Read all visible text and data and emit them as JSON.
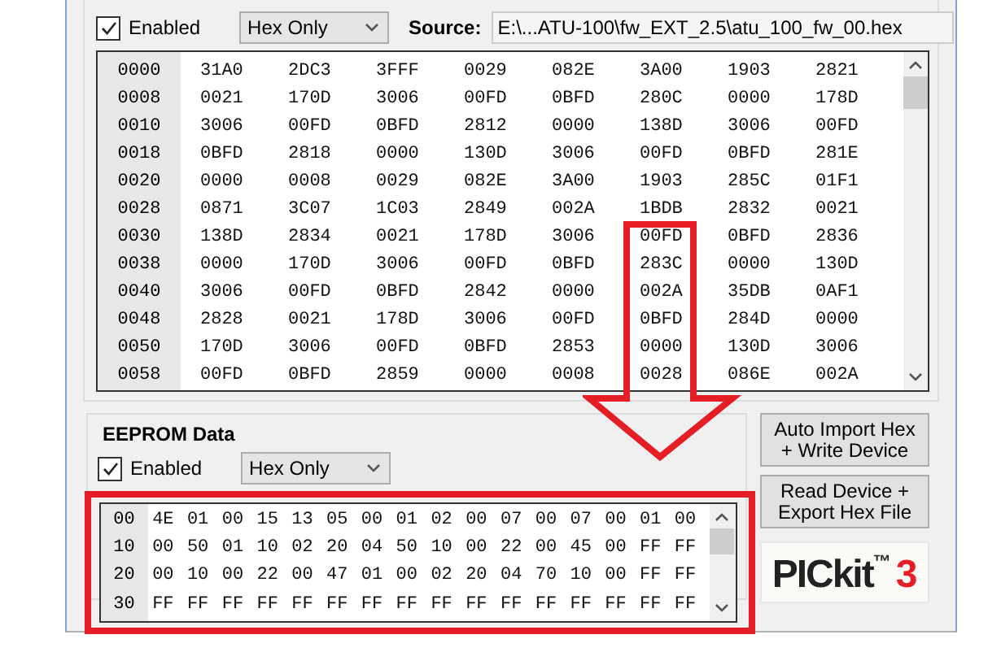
{
  "program_memory": {
    "enabled": true,
    "enabled_label": "Enabled",
    "mode": "Hex Only",
    "source_label": "Source:",
    "source": "E:\\...ATU-100\\fw_EXT_2.5\\atu_100_fw_00.hex",
    "rows": [
      {
        "address": "0000",
        "cells": [
          "31A0",
          "2DC3",
          "3FFF",
          "0029",
          "082E",
          "3A00",
          "1903",
          "2821"
        ]
      },
      {
        "address": "0008",
        "cells": [
          "0021",
          "170D",
          "3006",
          "00FD",
          "0BFD",
          "280C",
          "0000",
          "178D"
        ]
      },
      {
        "address": "0010",
        "cells": [
          "3006",
          "00FD",
          "0BFD",
          "2812",
          "0000",
          "138D",
          "3006",
          "00FD"
        ]
      },
      {
        "address": "0018",
        "cells": [
          "0BFD",
          "2818",
          "0000",
          "130D",
          "3006",
          "00FD",
          "0BFD",
          "281E"
        ]
      },
      {
        "address": "0020",
        "cells": [
          "0000",
          "0008",
          "0029",
          "082E",
          "3A00",
          "1903",
          "285C",
          "01F1"
        ]
      },
      {
        "address": "0028",
        "cells": [
          "0871",
          "3C07",
          "1C03",
          "2849",
          "002A",
          "1BDB",
          "2832",
          "0021"
        ]
      },
      {
        "address": "0030",
        "cells": [
          "138D",
          "2834",
          "0021",
          "178D",
          "3006",
          "00FD",
          "0BFD",
          "2836"
        ]
      },
      {
        "address": "0038",
        "cells": [
          "0000",
          "170D",
          "3006",
          "00FD",
          "0BFD",
          "283C",
          "0000",
          "130D"
        ]
      },
      {
        "address": "0040",
        "cells": [
          "3006",
          "00FD",
          "0BFD",
          "2842",
          "0000",
          "002A",
          "35DB",
          "0AF1"
        ]
      },
      {
        "address": "0048",
        "cells": [
          "2828",
          "0021",
          "178D",
          "3006",
          "00FD",
          "0BFD",
          "284D",
          "0000"
        ]
      },
      {
        "address": "0050",
        "cells": [
          "170D",
          "3006",
          "00FD",
          "0BFD",
          "2853",
          "0000",
          "130D",
          "3006"
        ]
      },
      {
        "address": "0058",
        "cells": [
          "00FD",
          "0BFD",
          "2859",
          "0000",
          "0008",
          "0028",
          "086E",
          "002A"
        ]
      }
    ]
  },
  "eeprom": {
    "title": "EEPROM Data",
    "enabled": true,
    "enabled_label": "Enabled",
    "mode": "Hex Only",
    "rows": [
      {
        "address": "00",
        "cells": [
          "4E",
          "01",
          "00",
          "15",
          "13",
          "05",
          "00",
          "01",
          "02",
          "00",
          "07",
          "00",
          "07",
          "00",
          "01",
          "00"
        ]
      },
      {
        "address": "10",
        "cells": [
          "00",
          "50",
          "01",
          "10",
          "02",
          "20",
          "04",
          "50",
          "10",
          "00",
          "22",
          "00",
          "45",
          "00",
          "FF",
          "FF"
        ]
      },
      {
        "address": "20",
        "cells": [
          "00",
          "10",
          "00",
          "22",
          "00",
          "47",
          "01",
          "00",
          "02",
          "20",
          "04",
          "70",
          "10",
          "00",
          "FF",
          "FF"
        ]
      },
      {
        "address": "30",
        "cells": [
          "FF",
          "FF",
          "FF",
          "FF",
          "FF",
          "FF",
          "FF",
          "FF",
          "FF",
          "FF",
          "FF",
          "FF",
          "FF",
          "FF",
          "FF",
          "FF"
        ]
      }
    ]
  },
  "buttons": [
    "Auto Import Hex\n+ Write Device",
    "Read Device +\nExport Hex File"
  ],
  "logo": {
    "name": "PICkit",
    "mark": "™",
    "number": "3"
  }
}
